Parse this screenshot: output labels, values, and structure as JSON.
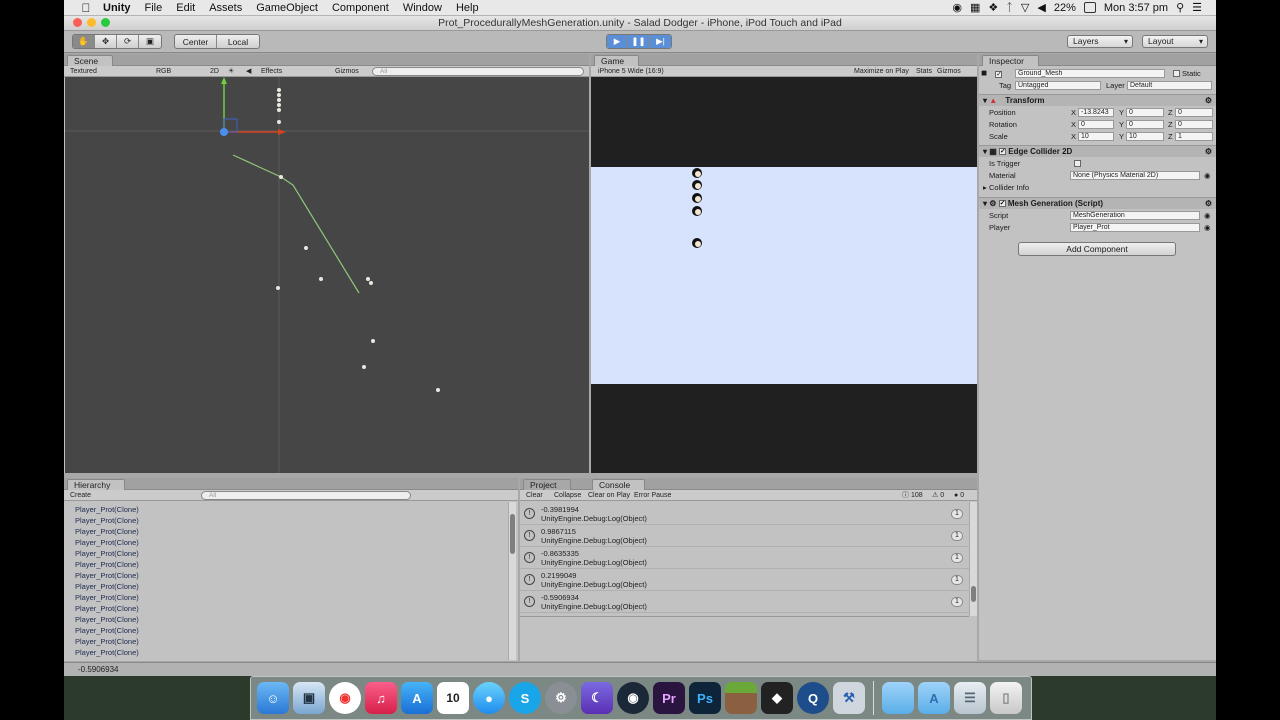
{
  "menubar": {
    "app": "Unity",
    "items": [
      "File",
      "Edit",
      "Assets",
      "GameObject",
      "Component",
      "Window",
      "Help"
    ],
    "battery": "22%",
    "clock": "Mon 3:57 pm"
  },
  "window": {
    "title": "Prot_ProcedurallyMeshGeneration.unity - Salad Dodger - iPhone, iPod Touch and iPad"
  },
  "toolbar": {
    "pivot": "Center",
    "space": "Local",
    "layers": "Layers",
    "layout": "Layout"
  },
  "scene": {
    "tab": "Scene",
    "shading": "Textured",
    "render_mode": "RGB",
    "mode_2d": "2D",
    "effects": "Effects",
    "gizmos": "Gizmos",
    "search_placeholder": "All"
  },
  "game": {
    "tab": "Game",
    "aspect": "iPhone 5 Wide (16:9)",
    "maximize": "Maximize on Play",
    "stats": "Stats",
    "gizmos": "Gizmos"
  },
  "inspector": {
    "tab": "Inspector",
    "object_name": "Ground_Mesh",
    "static_label": "Static",
    "tag_label": "Tag",
    "tag_value": "Untagged",
    "layer_label": "Layer",
    "layer_value": "Default",
    "transform": {
      "title": "Transform",
      "position_label": "Position",
      "position": {
        "x": "-13.8243",
        "y": "0",
        "z": "0"
      },
      "rotation_label": "Rotation",
      "rotation": {
        "x": "0",
        "y": "0",
        "z": "0"
      },
      "scale_label": "Scale",
      "scale": {
        "x": "10",
        "y": "10",
        "z": "1"
      }
    },
    "edge_collider": {
      "title": "Edge Collider 2D",
      "is_trigger_label": "Is Trigger",
      "material_label": "Material",
      "material_value": "None (Physics Material 2D)",
      "collider_info": "Collider Info"
    },
    "mesh_generation": {
      "title": "Mesh Generation (Script)",
      "script_label": "Script",
      "script_value": "MeshGeneration",
      "player_label": "Player",
      "player_value": "Player_Prot"
    },
    "add_component": "Add Component"
  },
  "hierarchy": {
    "tab": "Hierarchy",
    "create": "Create",
    "search_placeholder": "All",
    "items": [
      "Player_Prot(Clone)",
      "Player_Prot(Clone)",
      "Player_Prot(Clone)",
      "Player_Prot(Clone)",
      "Player_Prot(Clone)",
      "Player_Prot(Clone)",
      "Player_Prot(Clone)",
      "Player_Prot(Clone)",
      "Player_Prot(Clone)",
      "Player_Prot(Clone)",
      "Player_Prot(Clone)",
      "Player_Prot(Clone)",
      "Player_Prot(Clone)",
      "Player_Prot(Clone)"
    ]
  },
  "console": {
    "project_tab": "Project",
    "console_tab": "Console",
    "buttons": [
      "Clear",
      "Collapse",
      "Clear on Play",
      "Error Pause"
    ],
    "log_count": "108",
    "warn_count": "0",
    "error_count": "0",
    "entries": [
      {
        "value": "-0.3981994",
        "source": "UnityEngine.Debug:Log(Object)",
        "count": "1"
      },
      {
        "value": "0.9867115",
        "source": "UnityEngine.Debug:Log(Object)",
        "count": "1"
      },
      {
        "value": "-0.8635335",
        "source": "UnityEngine.Debug:Log(Object)",
        "count": "1"
      },
      {
        "value": "0.2199049",
        "source": "UnityEngine.Debug:Log(Object)",
        "count": "1"
      },
      {
        "value": "-0.5906934",
        "source": "UnityEngine.Debug:Log(Object)",
        "count": "1"
      }
    ]
  },
  "status": {
    "text": "-0.5906934"
  },
  "dock": {
    "apps": [
      "finder-icon",
      "preview-icon",
      "chrome-icon",
      "itunes-icon",
      "app-store-icon",
      "calendar-icon",
      "messages-icon",
      "skype-icon",
      "system-preferences-icon",
      "crescent-icon",
      "steam-icon",
      "premiere-icon",
      "photoshop-icon",
      "minecraft-icon",
      "unity-icon",
      "quicktime-icon",
      "xcode-icon",
      "folder-icon",
      "applications-folder-icon",
      "documents-folder-icon",
      "trash-icon"
    ],
    "calendar_day": "10",
    "premiere": "Pr",
    "photoshop": "Ps"
  }
}
